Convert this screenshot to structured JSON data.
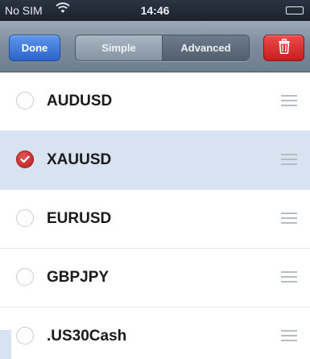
{
  "status_bar": {
    "carrier": "No SIM",
    "time": "14:46",
    "wifi_icon": "wifi-icon",
    "battery_icon": "battery-icon"
  },
  "toolbar": {
    "done_label": "Done",
    "segments": [
      "Simple",
      "Advanced"
    ],
    "selected_segment": "Advanced",
    "trash_icon": "trash-icon",
    "colors": {
      "done": "#2c64c9",
      "trash": "#c41e1e",
      "selected_row": "#d7e3f1"
    }
  },
  "symbols": [
    {
      "label": "AUDUSD",
      "checked": false
    },
    {
      "label": "XAUUSD",
      "checked": true
    },
    {
      "label": "EURUSD",
      "checked": false
    },
    {
      "label": "GBPJPY",
      "checked": false
    },
    {
      "label": ".US30Cash",
      "checked": false
    }
  ]
}
